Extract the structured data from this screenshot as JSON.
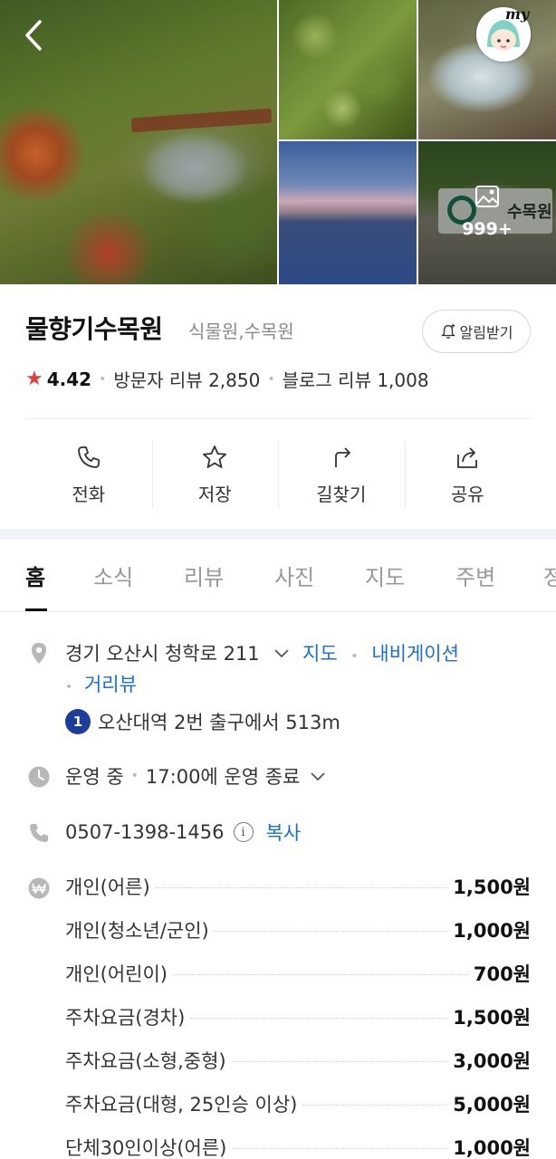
{
  "gallery": {
    "photo_count": "999+",
    "sign_text": "수목원"
  },
  "avatar": {
    "badge": "my"
  },
  "place": {
    "name": "물향기수목원",
    "category": "식물원,수목원",
    "notify_label": "알림받기",
    "rating": "4.42",
    "visitor_reviews": "방문자 리뷰 2,850",
    "blog_reviews": "블로그 리뷰 1,008"
  },
  "actions": [
    {
      "label": "전화",
      "icon": "phone-icon"
    },
    {
      "label": "저장",
      "icon": "star-icon"
    },
    {
      "label": "길찾기",
      "icon": "directions-icon"
    },
    {
      "label": "공유",
      "icon": "share-icon"
    }
  ],
  "tabs": [
    "홈",
    "소식",
    "리뷰",
    "사진",
    "지도",
    "주변",
    "정"
  ],
  "info": {
    "address": "경기 오산시 청학로 211",
    "map_link": "지도",
    "navigation_link": "내비게이션",
    "street_view_link": "거리뷰",
    "subway_line": "1",
    "subway_text": "오산대역 2번 출구에서 513m",
    "status": "운영 중",
    "closing": "17:00에 운영 종료",
    "phone": "0507-1398-1456",
    "copy_label": "복사"
  },
  "prices": [
    {
      "label": "개인(어른)",
      "value": "1,500원"
    },
    {
      "label": "개인(청소년/군인)",
      "value": "1,000원"
    },
    {
      "label": "개인(어린이)",
      "value": "700원"
    },
    {
      "label": "주차요금(경차)",
      "value": "1,500원"
    },
    {
      "label": "주차요금(소형,중형)",
      "value": "3,000원"
    },
    {
      "label": "주차요금(대형, 25인승 이상)",
      "value": "5,000원"
    },
    {
      "label": "단체30인이상(어른)",
      "value": "1,000원"
    }
  ],
  "colors": {
    "accent_link": "#1a6fd1",
    "star": "#e03d3d",
    "subway_line_1": "#1c3d99"
  }
}
